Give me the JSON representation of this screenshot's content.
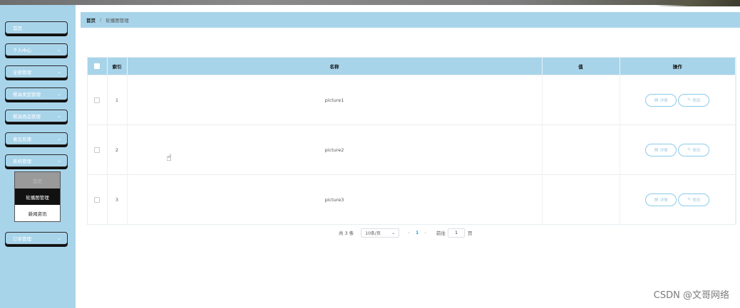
{
  "sidebar": {
    "items": [
      {
        "label": "首页",
        "has_chevron": false
      },
      {
        "label": "个人中心",
        "has_chevron": true
      },
      {
        "label": "全部管理",
        "has_chevron": true
      },
      {
        "label": "餐具类型管理",
        "has_chevron": true
      },
      {
        "label": "餐具商品管理",
        "has_chevron": true
      },
      {
        "label": "意见反馈",
        "has_chevron": true
      },
      {
        "label": "系统管理",
        "has_chevron": true
      },
      {
        "label": "订单管理",
        "has_chevron": true
      }
    ],
    "submenu": [
      {
        "label": "首页",
        "state": "disabled"
      },
      {
        "label": "轮播图管理",
        "state": "active"
      },
      {
        "label": "新闻资讯",
        "state": "normal"
      }
    ],
    "chevron_glyph": "⌄"
  },
  "breadcrumb": {
    "home": "首页",
    "current": "轮播图管理"
  },
  "table": {
    "headers": {
      "index": "索引",
      "name": "名称",
      "value": "值",
      "actions": "操作"
    },
    "rows": [
      {
        "index": "1",
        "name": "picture1",
        "value": ""
      },
      {
        "index": "2",
        "name": "picture2",
        "value": ""
      },
      {
        "index": "3",
        "name": "picture3",
        "value": ""
      }
    ],
    "detail_label": "详情",
    "edit_label": "修改"
  },
  "pagination": {
    "total_text": "共 3 条",
    "page_size": "10条/页",
    "current_page": "1",
    "goto_label": "前往",
    "goto_value": "1",
    "goto_suffix": "页"
  },
  "watermark": "CSDN @文哥网络",
  "colors": {
    "accent": "#a8d4ea",
    "page_active": "#2aa7d6"
  }
}
